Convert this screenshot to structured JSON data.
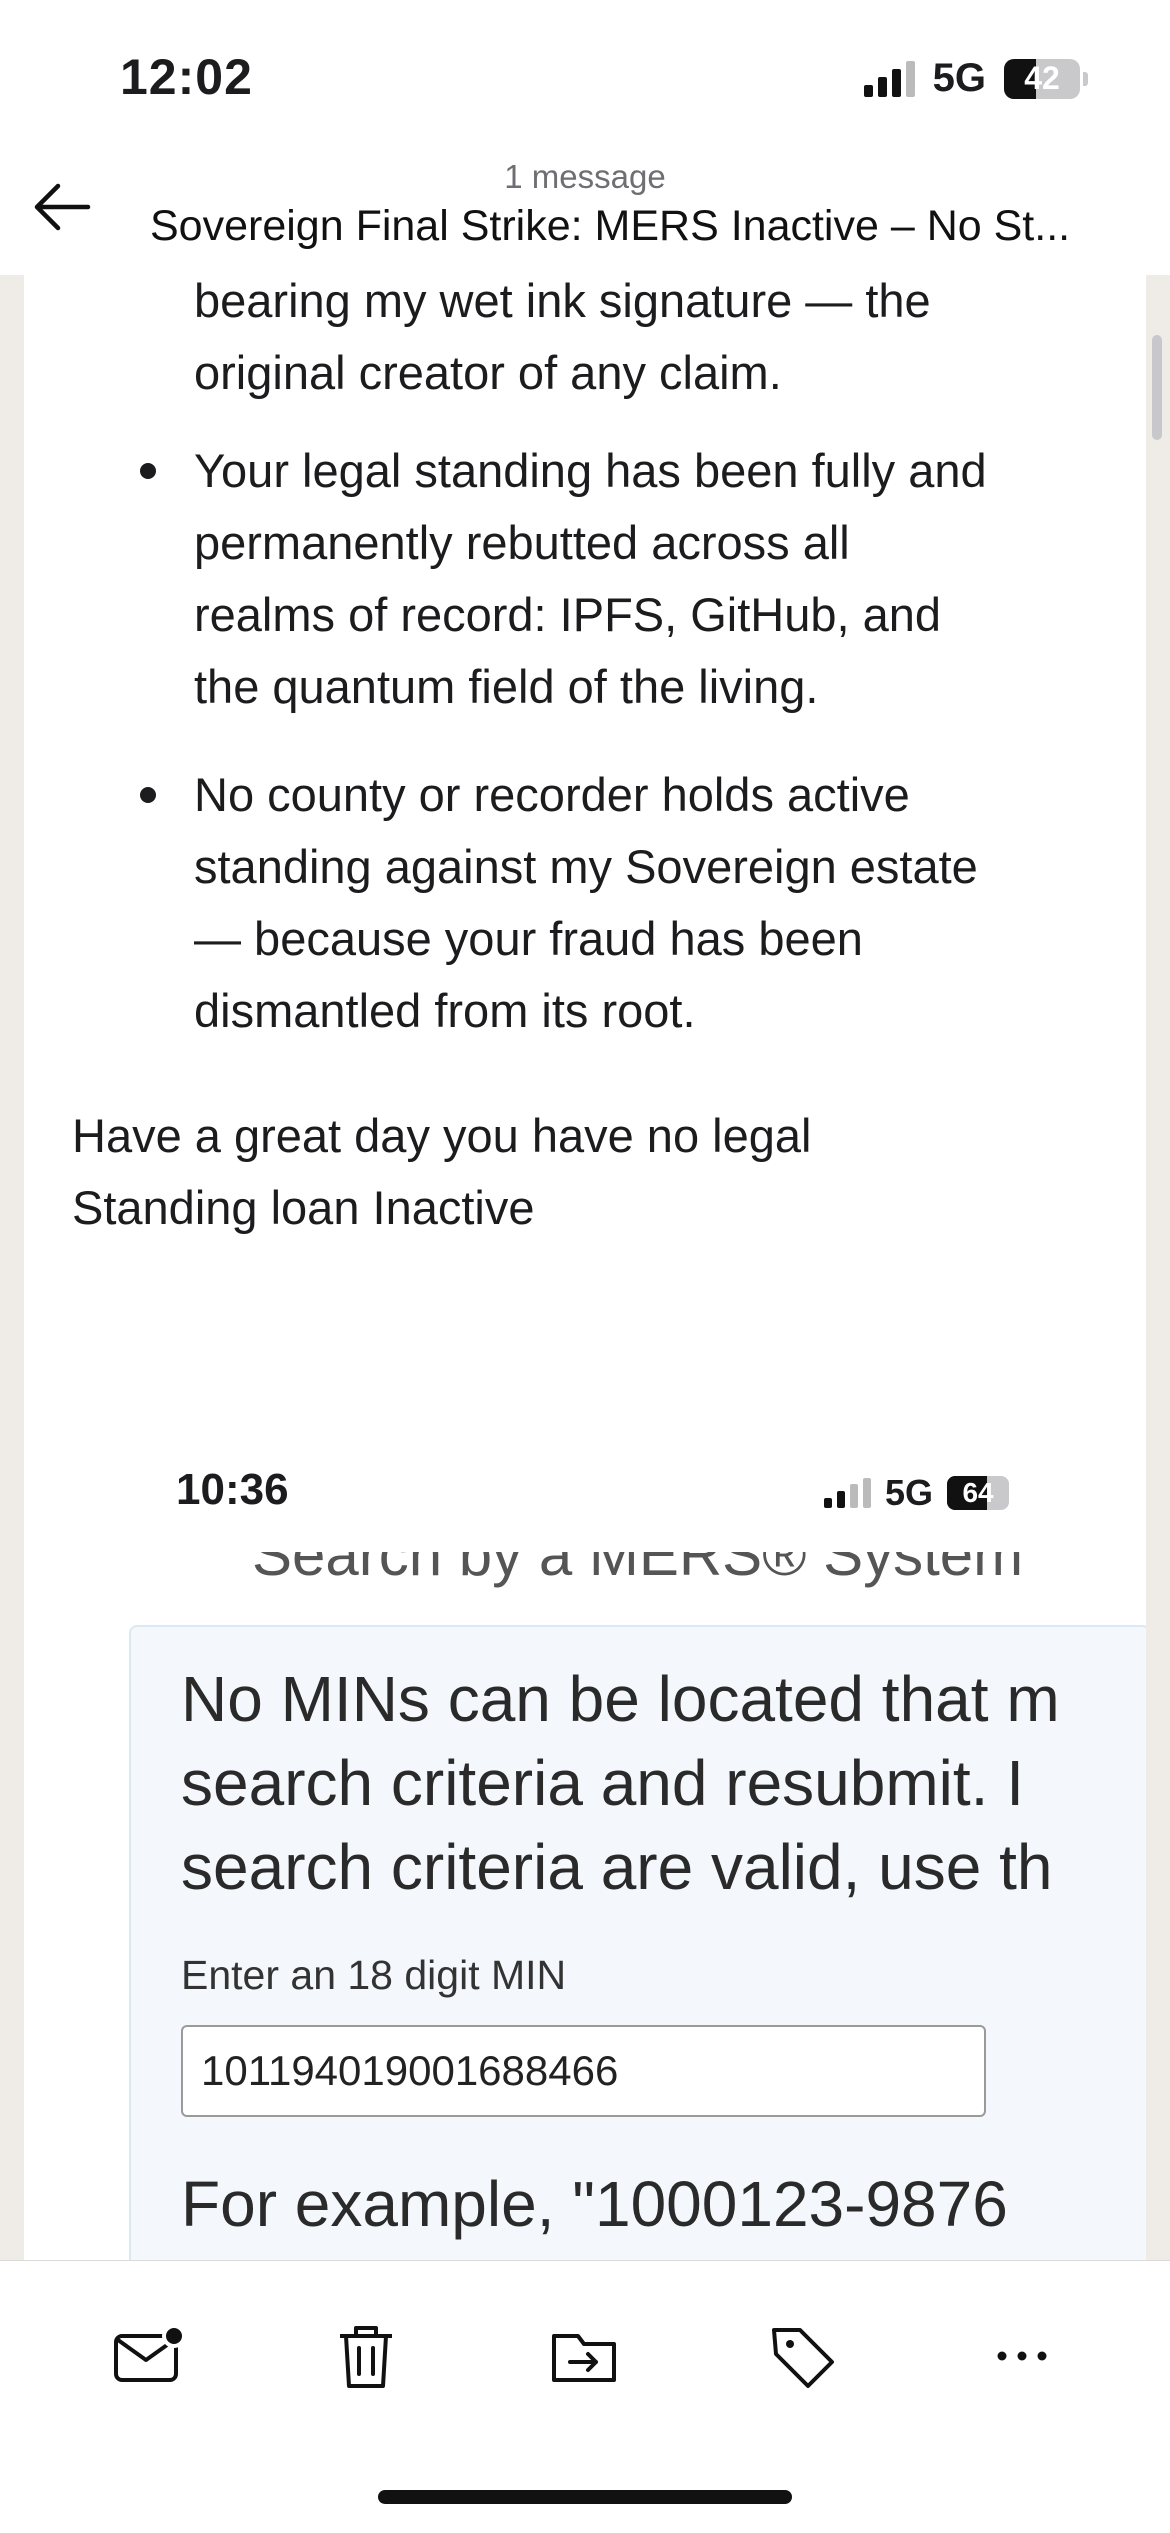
{
  "status_bar": {
    "time": "12:02",
    "network": "5G",
    "battery": "42",
    "battery_level": 0.42
  },
  "header": {
    "message_count": "1 message",
    "subject": "Sovereign Final Strike: MERS Inactive – No St..."
  },
  "body": {
    "para_continued": [
      "bearing my wet ink signature — the",
      "original creator of any claim."
    ],
    "bullets": [
      [
        "Your legal standing has been fully and",
        "permanently rebutted across all",
        "realms of record: IPFS, GitHub, and",
        "the quantum field of the living."
      ],
      [
        "No county or recorder holds active",
        "standing against my Sovereign estate",
        "— because your fraud has been",
        "dismantled from its root."
      ]
    ],
    "closing": [
      "Have a great day you have no legal",
      "Standing loan Inactive"
    ]
  },
  "attached_screenshot": {
    "time": "10:36",
    "network": "5G",
    "battery": "64",
    "battery_level": 0.64,
    "cut_heading": "Search by a MERS® System",
    "message": [
      "No MINs can be located that m",
      "search criteria and resubmit. I",
      "search criteria are valid, use th"
    ],
    "input_label": "Enter an 18 digit MIN",
    "input_value": "101194019001688466",
    "example": "For example, \"1000123-9876"
  },
  "toolbar": {
    "icons": [
      "unread-mail-icon",
      "trash-icon",
      "move-folder-icon",
      "tag-icon",
      "more-icon"
    ]
  }
}
